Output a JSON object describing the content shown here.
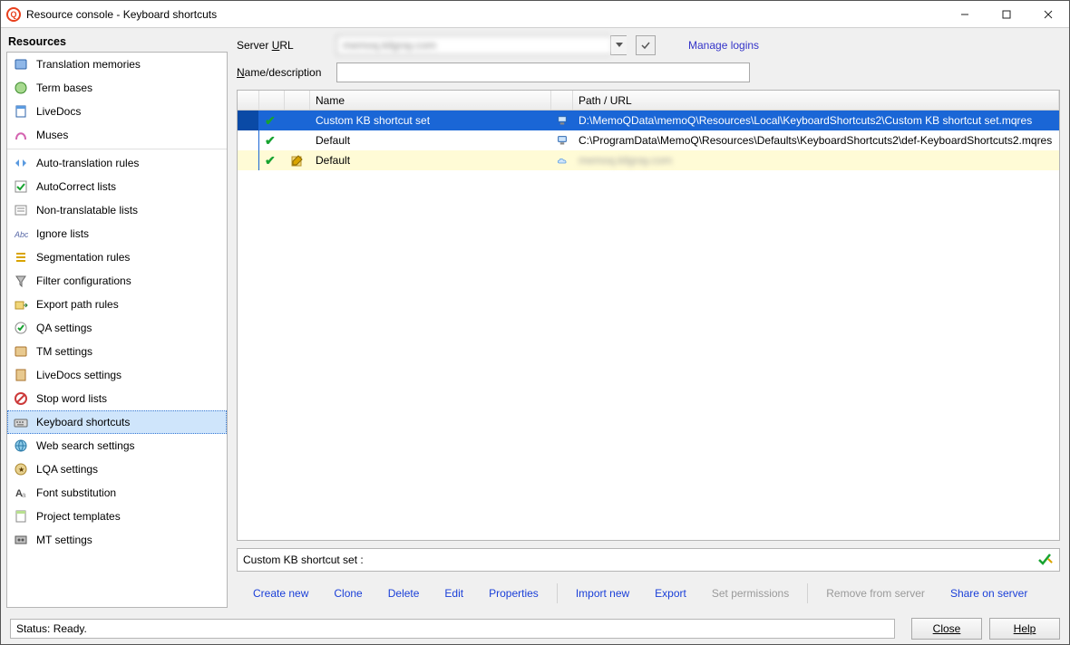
{
  "window": {
    "title": "Resource console - Keyboard shortcuts"
  },
  "sidebar": {
    "title": "Resources",
    "items": [
      {
        "label": "Translation memories",
        "icon": "tm"
      },
      {
        "label": "Term bases",
        "icon": "tb"
      },
      {
        "label": "LiveDocs",
        "icon": "ld"
      },
      {
        "label": "Muses",
        "icon": "mu"
      },
      {
        "label": "Auto-translation rules",
        "icon": "at"
      },
      {
        "label": "AutoCorrect lists",
        "icon": "ac"
      },
      {
        "label": "Non-translatable lists",
        "icon": "nt"
      },
      {
        "label": "Ignore lists",
        "icon": "ig"
      },
      {
        "label": "Segmentation rules",
        "icon": "sg"
      },
      {
        "label": "Filter configurations",
        "icon": "fc"
      },
      {
        "label": "Export path rules",
        "icon": "ep"
      },
      {
        "label": "QA settings",
        "icon": "qa"
      },
      {
        "label": "TM settings",
        "icon": "ts"
      },
      {
        "label": "LiveDocs settings",
        "icon": "ls"
      },
      {
        "label": "Stop word lists",
        "icon": "sw"
      },
      {
        "label": "Keyboard shortcuts",
        "icon": "kb",
        "selected": true
      },
      {
        "label": "Web search settings",
        "icon": "ws"
      },
      {
        "label": "LQA settings",
        "icon": "lq"
      },
      {
        "label": "Font substitution",
        "icon": "fs"
      },
      {
        "label": "Project templates",
        "icon": "pt"
      },
      {
        "label": "MT settings",
        "icon": "mt"
      }
    ],
    "dividerAfterIndex": 3
  },
  "top": {
    "serverLabel": "Server URL",
    "serverUrl": "memoq.kilgray.com",
    "manage": "Manage logins",
    "nameDesc": "Name/description"
  },
  "grid": {
    "head": {
      "name": "Name",
      "path": "Path / URL"
    },
    "rows": [
      {
        "sel": true,
        "check": true,
        "name": "Custom KB shortcut set",
        "loc": "pc",
        "path": "D:\\MemoQData\\memoQ\\Resources\\Local\\KeyboardShortcuts2\\Custom KB shortcut set.mqres"
      },
      {
        "check": true,
        "name": "Default",
        "loc": "pc",
        "path": "C:\\ProgramData\\MemoQ\\Resources\\Defaults\\KeyboardShortcuts2\\def-KeyboardShortcuts2.mqres"
      },
      {
        "alt": true,
        "check": true,
        "edit": true,
        "name": "Default",
        "loc": "cloud",
        "path": "memoq.kilgray.com",
        "blur": true
      }
    ]
  },
  "desc": {
    "text": "Custom KB shortcut set :"
  },
  "actions": {
    "createNew": "Create new",
    "clone": "Clone",
    "delete": "Delete",
    "edit": "Edit",
    "properties": "Properties",
    "importNew": "Import new",
    "export": "Export",
    "setPerm": "Set permissions",
    "remove": "Remove from server",
    "share": "Share on server"
  },
  "footer": {
    "status": "Status: Ready.",
    "close": "Close",
    "help": "Help"
  }
}
